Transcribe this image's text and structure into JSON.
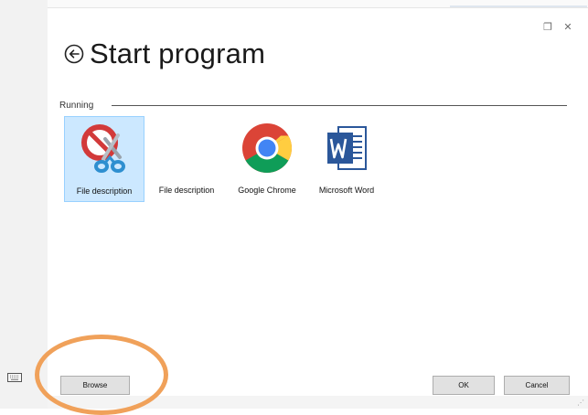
{
  "window": {
    "restore_label": "❐",
    "close_label": "✕"
  },
  "header": {
    "back_icon": "back-arrow-circle-icon",
    "title": "Start program"
  },
  "group": {
    "label": "Running"
  },
  "programs": [
    {
      "label": "File description",
      "icon": "snipping-tool-icon",
      "selected": true
    },
    {
      "label": "File description",
      "icon": "blank-program-icon",
      "selected": false
    },
    {
      "label": "Google Chrome",
      "icon": "chrome-icon",
      "selected": false
    },
    {
      "label": "Microsoft Word",
      "icon": "word-icon",
      "selected": false
    }
  ],
  "footer": {
    "browse_label": "Browse",
    "ok_label": "OK",
    "cancel_label": "Cancel",
    "keyboard_icon": "keyboard-icon"
  },
  "colors": {
    "selection_bg": "#cce8ff",
    "selection_border": "#99d1ff",
    "annotation_circle": "#f0a15a",
    "word_blue": "#2b579a"
  }
}
